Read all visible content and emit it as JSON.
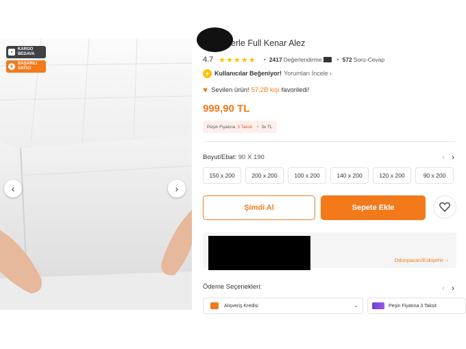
{
  "gallery": {
    "badges": {
      "kargo": "KARGO BEDAVA",
      "kargo_line1": "KARGO",
      "kargo_line2": "BEDAVA",
      "satici_line1": "BAŞARILI",
      "satici_line2": "SATICI"
    },
    "prev_icon": "chevron-left-icon",
    "next_icon": "chevron-right-icon"
  },
  "product": {
    "title": "erle Full Kenar Alez",
    "rating_value": "4.7",
    "rating_stars": 4.7,
    "review_count": "2417",
    "review_label": "Değerlendirme",
    "qa_count": "572",
    "qa_label": "Soru-Cevap",
    "liked_bold": "Kullanıcılar Beğeniyor!",
    "liked_link": "Yorumları İncele",
    "fav_lead": "Sevilen ürün!",
    "fav_count": "57,2B kişi",
    "fav_tail": "favoriledi!",
    "price": "999,90 TL",
    "installment_lead": "Peşin Fiyatına",
    "installment_highlight": "3 Taksit",
    "installment_tail": "3x TL"
  },
  "size": {
    "label_key": "Boyut/Ebat:",
    "label_value": "90 X 190",
    "options": [
      "150 x 200",
      "200 x 200",
      "100 x 200",
      "140 x 200",
      "120 x 200",
      "90 x 200"
    ]
  },
  "actions": {
    "buy_now": "Şimdi Al",
    "add_to_cart": "Sepete Ekle"
  },
  "seller": {
    "location": "Odunpazarı/Eskişehir"
  },
  "payment": {
    "label": "Ödeme Seçenekleri:",
    "options": [
      "Alışveriş Kredisi",
      "Peşin Fiyatına 3 Taksit"
    ]
  },
  "colors": {
    "accent": "#f27a1a",
    "star": "#ffc000",
    "installment_bg": "#fdf0ec"
  }
}
